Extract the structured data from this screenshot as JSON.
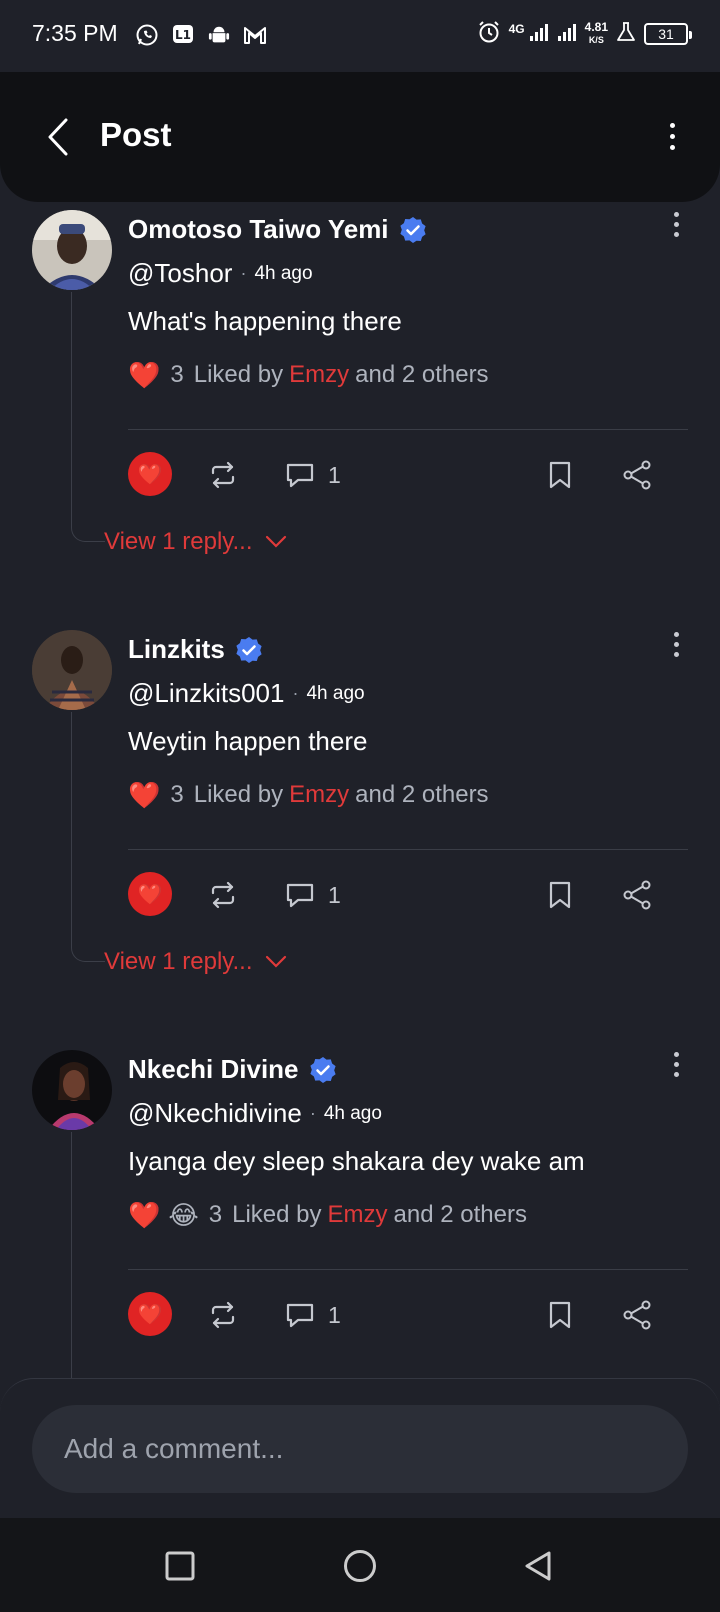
{
  "status_bar": {
    "time": "7:35 PM",
    "network": "4G",
    "speed_value": "4.81",
    "speed_unit": "K/S",
    "battery": "31",
    "icons": [
      "whatsapp-icon",
      "notification-icon",
      "android-icon",
      "gmail-icon",
      "alarm-icon",
      "signal-icon",
      "signal-icon",
      "lab-icon",
      "battery-icon"
    ]
  },
  "header": {
    "title": "Post"
  },
  "comments": [
    {
      "name": "Omotoso Taiwo Yemi",
      "handle": "@Toshor",
      "time": "4h ago",
      "text": "What's happening there",
      "reactions": [
        "❤️"
      ],
      "like_count": "3",
      "liked_by_prefix": "Liked by",
      "liked_by_name": "Emzy",
      "liked_by_suffix": "and 2 others",
      "comment_count": "1",
      "view_replies": "View 1 reply..."
    },
    {
      "name": "Linzkits",
      "handle": "@Linzkits001",
      "time": "4h ago",
      "text": "Weytin happen there",
      "reactions": [
        "❤️"
      ],
      "like_count": "3",
      "liked_by_prefix": "Liked by",
      "liked_by_name": "Emzy",
      "liked_by_suffix": "and 2 others",
      "comment_count": "1",
      "view_replies": "View 1 reply..."
    },
    {
      "name": "Nkechi Divine",
      "handle": "@Nkechidivine",
      "time": "4h ago",
      "text": "Iyanga dey sleep shakara dey wake am",
      "reactions": [
        "❤️",
        "😂"
      ],
      "like_count": "3",
      "liked_by_prefix": "Liked by",
      "liked_by_name": "Emzy",
      "liked_by_suffix": "and 2 others",
      "comment_count": "1"
    }
  ],
  "comment_box": {
    "placeholder": "Add a comment..."
  },
  "colors": {
    "background": "#1f2129",
    "header": "#101114",
    "accent_red": "#e02424",
    "verified_blue": "#4a7cf0"
  }
}
